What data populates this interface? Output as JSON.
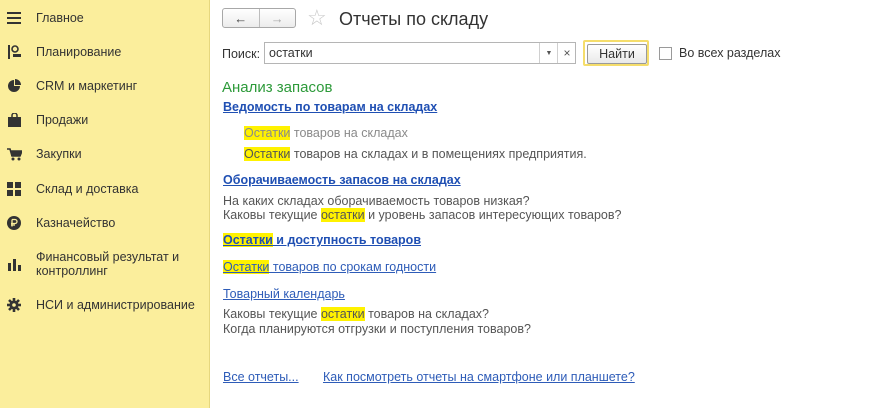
{
  "sidebar": {
    "items": [
      {
        "icon": "menu-lines-icon",
        "label": "Главное"
      },
      {
        "icon": "planning-icon",
        "label": "Планирование"
      },
      {
        "icon": "pie-chart-icon",
        "label": "CRM и маркетинг"
      },
      {
        "icon": "shopping-bag-icon",
        "label": "Продажи"
      },
      {
        "icon": "cart-icon",
        "label": "Закупки"
      },
      {
        "icon": "warehouse-icon",
        "label": "Склад и доставка"
      },
      {
        "icon": "coin-icon",
        "label": "Казначейство"
      },
      {
        "icon": "bar-chart-icon",
        "label": "Финансовый результат и контроллинг"
      },
      {
        "icon": "gear-icon",
        "label": "НСИ и администрирование"
      }
    ]
  },
  "header": {
    "back": "←",
    "forward": "→",
    "star": "☆",
    "title": "Отчеты по складу"
  },
  "search": {
    "label": "Поиск:",
    "value": "остатки",
    "dropdown": "▼",
    "clear": "×",
    "find_label": "Найти",
    "all_sections_label": "Во всех разделах"
  },
  "group": {
    "title": "Анализ запасов"
  },
  "report1": {
    "title": "Ведомость по товарам на складах",
    "sub1_hl": "Остатки",
    "sub1_rest": " товаров на складах",
    "sub2_hl": "Остатки",
    "sub2_rest": " товаров на складах и в помещениях предприятия."
  },
  "report2": {
    "title": "Оборачиваемость запасов на складах",
    "desc1": "На каких складах оборачиваемость товаров низкая?",
    "desc2_pre": "Каковы текущие ",
    "desc2_hl": "остатки",
    "desc2_post": " и уровень запасов интересующих товаров?"
  },
  "report3": {
    "title_hl": "Остатки",
    "title_rest": " и доступность товаров"
  },
  "report4": {
    "title_hl": "Остатки",
    "title_rest": " товаров по срокам годности"
  },
  "report5": {
    "title": "Товарный календарь",
    "desc1_pre": "Каковы текущие ",
    "desc1_hl": "остатки",
    "desc1_post": " товаров на складах?",
    "desc2": "Когда планируются отгрузки и поступления товаров?"
  },
  "footer": {
    "all_reports": "Все отчеты...",
    "mobile_link": "Как посмотреть отчеты на смартфоне или планшете?"
  },
  "colors": {
    "sidebar_bg": "#fbee9c",
    "highlight": "#fff200",
    "group_title": "#2d9a3a",
    "link": "#2e5cb8"
  }
}
